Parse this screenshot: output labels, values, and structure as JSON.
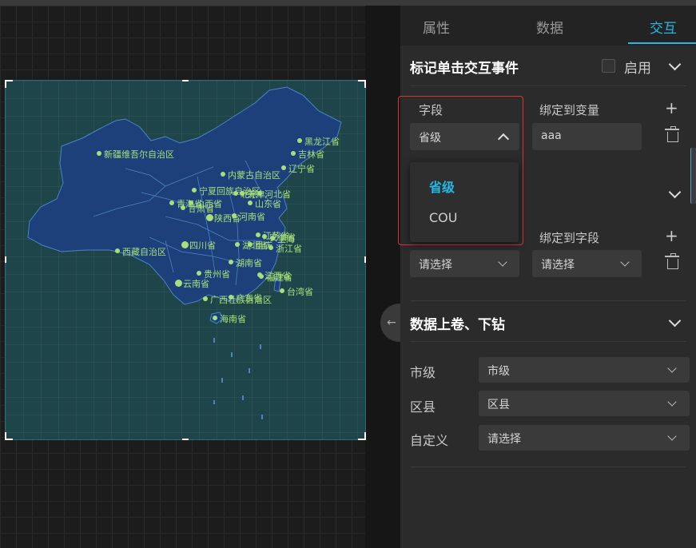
{
  "tabs": [
    {
      "label": "属性"
    },
    {
      "label": "数据"
    },
    {
      "label": "交互"
    }
  ],
  "active_tab": "交互",
  "section1": {
    "title": "标记单击交互事件",
    "enable_label": "启用"
  },
  "field_row": {
    "field_label": "字段",
    "bind_var_label": "绑定到变量",
    "field_value": "省级",
    "var_value": "aaa"
  },
  "dropdown": {
    "options": [
      {
        "label": "省级",
        "selected": true
      },
      {
        "label": "COU",
        "selected": false
      }
    ]
  },
  "field_row2": {
    "bind_field_label": "绑定到字段",
    "select1": "请选择",
    "select2": "请选择"
  },
  "drill": {
    "title": "数据上卷、下钻",
    "rows": [
      {
        "label": "市级",
        "value": "市级"
      },
      {
        "label": "区县",
        "value": "区县"
      },
      {
        "label": "自定义",
        "value": "请选择"
      }
    ]
  },
  "map": {
    "labels": [
      "黑龙江省",
      "吉林省",
      "辽宁省",
      "新疆维吾尔自治区",
      "内蒙古自治区",
      "宁夏回族自治区",
      "北京",
      "天津",
      "山西省",
      "河北省",
      "青海省",
      "甘肃省",
      "山东省",
      "陕西省",
      "河南省",
      "江苏省",
      "安徽省",
      "上海",
      "浙江省",
      "西藏自治区",
      "四川省",
      "湖北省",
      "重庆",
      "湖南省",
      "江西省",
      "贵州省",
      "福建省",
      "云南省",
      "广西壮族自治区",
      "广东省",
      "台湾省",
      "海南省"
    ],
    "colors": {
      "land": "#1d3f7a",
      "border": "#4d84c4",
      "label": "#a7e07a",
      "bg": "#1e4549"
    }
  }
}
